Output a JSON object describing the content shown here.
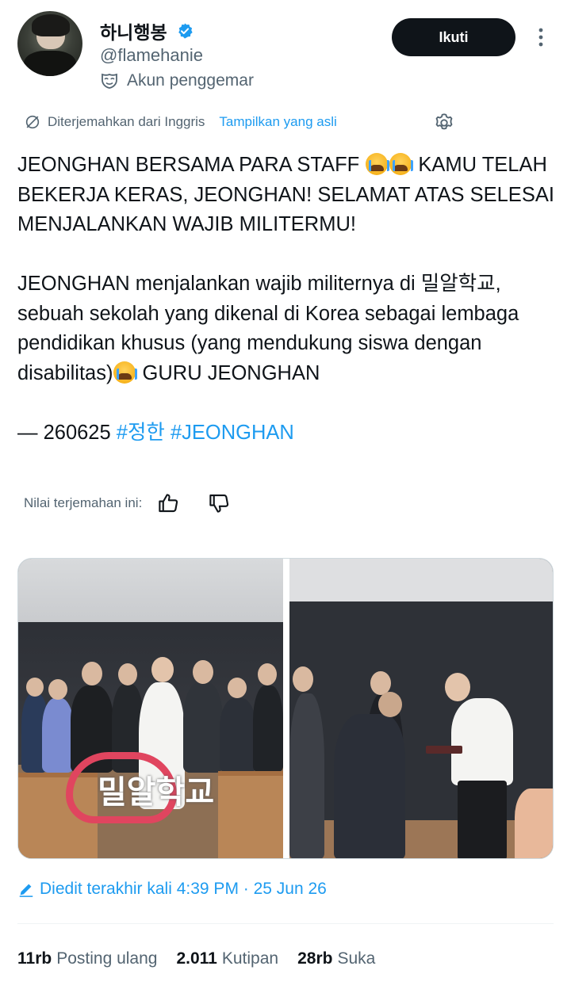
{
  "author": {
    "display_name": "하니행봉",
    "handle": "@flamehanie",
    "fan_label": "Akun penggemar",
    "avatar_icon": "avatar",
    "verified_icon": "verified-badge-icon",
    "verified_color": "#1d9bf0"
  },
  "header": {
    "follow_label": "Ikuti",
    "more_icon": "more-vertical-icon"
  },
  "translation": {
    "translated_from": "Diterjemahkan dari Inggris",
    "show_original": "Tampilkan yang asli",
    "rate_label": "Nilai terjemahan ini:"
  },
  "tweet": {
    "line1_a": "JEONGHAN BERSAMA PARA STAFF ",
    "line1_b": " KAMU TELAH BEKERJA KERAS, JEONGHAN! SELAMAT ATAS SELESAI MENJALANKAN WAJIB MILITERMU!",
    "para2_a": "JEONGHAN menjalankan wajib militernya di 밀알학교, sebuah sekolah yang dikenal di Korea sebagai lembaga pendidikan khusus (yang mendukung siswa dengan disabilitas)",
    "para2_b": " GURU JEONGHAN",
    "date_prefix": "— 260625 ",
    "hashtag1": "#정한",
    "hashtag2": "#JEONGHAN",
    "emoji_name": "loudly-crying-face"
  },
  "media": {
    "sign_text": "밀알학교"
  },
  "edited": {
    "text": "Diedit terakhir kali 4:39 PM · 25 Jun 26"
  },
  "stats": {
    "reposts_count": "11rb",
    "reposts_label": "Posting ulang",
    "quotes_count": "2.011",
    "quotes_label": "Kutipan",
    "likes_count": "28rb",
    "likes_label": "Suka"
  },
  "colors": {
    "accent": "#1d9bf0",
    "text_primary": "#0f1419",
    "text_secondary": "#536471"
  }
}
